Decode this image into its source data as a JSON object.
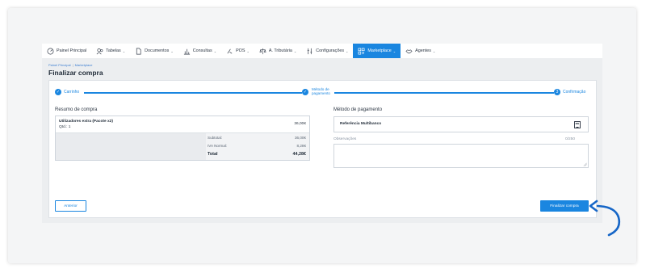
{
  "nav": {
    "items": [
      {
        "label": "Painel Principal",
        "icon": "dashboard-icon",
        "has_chevron": false
      },
      {
        "label": "Tabelas",
        "icon": "users-icon",
        "has_chevron": true
      },
      {
        "label": "Documentos",
        "icon": "document-icon",
        "has_chevron": true
      },
      {
        "label": "Consultas",
        "icon": "bar-chart-icon",
        "has_chevron": true
      },
      {
        "label": "POS",
        "icon": "pos-icon",
        "has_chevron": true
      },
      {
        "label": "A. Tributária",
        "icon": "scales-icon",
        "has_chevron": true
      },
      {
        "label": "Configurações",
        "icon": "settings-icon",
        "has_chevron": true
      },
      {
        "label": "Marketplace",
        "icon": "marketplace-icon",
        "has_chevron": true,
        "active": true
      },
      {
        "label": "Agentes",
        "icon": "handshake-icon",
        "has_chevron": true
      }
    ]
  },
  "breadcrumb": {
    "home": "Painel Principal",
    "separator": "|",
    "current": "Marketplace"
  },
  "page_title": "Finalizar compra",
  "stepper": {
    "step1": "Carrinho",
    "step2_line1": "Método de",
    "step2_line2": "pagamento",
    "step3_number": "3",
    "step3": "Confirmação"
  },
  "summary": {
    "title": "Resumo de compra",
    "item_name": "Utilizadores extra (Pacote x2)",
    "item_qty": "Qtd.: 1",
    "item_price": "36,00€",
    "subtotal_label": "Subtotal:",
    "subtotal_value": "36,00€",
    "iva_label": "IVA Normal:",
    "iva_value": "8,28€",
    "total_label": "Total",
    "total_value": "44,28€"
  },
  "payment": {
    "title": "Método de pagamento",
    "method": "Referência Multibanco",
    "method_icon": "multibanco-icon",
    "obs_label": "Observações",
    "obs_count": "0/250",
    "obs_value": ""
  },
  "buttons": {
    "previous": "Anterior",
    "finish": "Finalizar compra"
  },
  "colors": {
    "accent": "#1a86e0",
    "accent_dark": "#1666c7"
  }
}
